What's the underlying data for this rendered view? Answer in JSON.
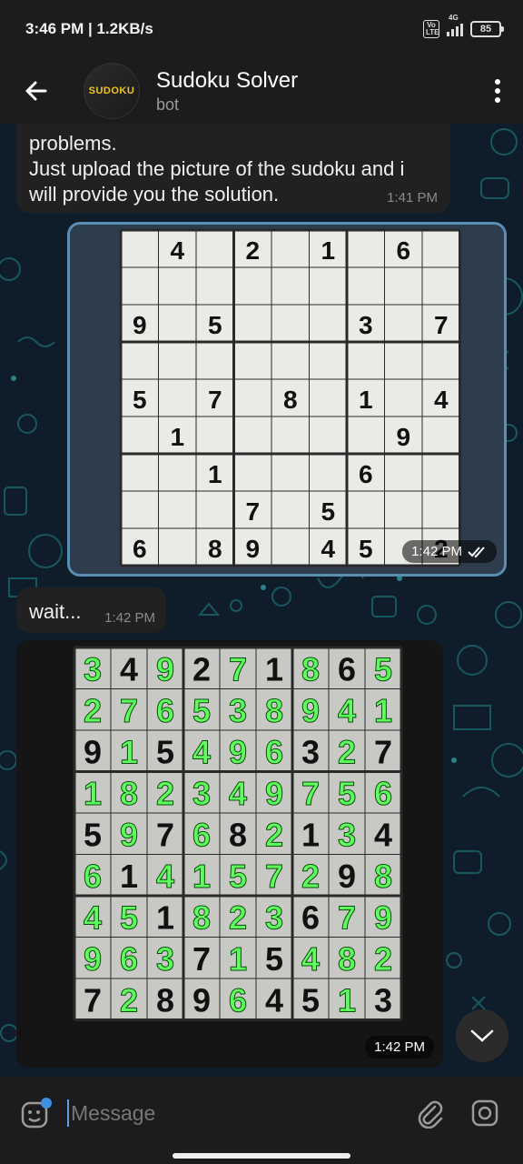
{
  "status": {
    "time": "3:46 PM | 1.2KB/s",
    "volte": "Vo LTE",
    "network": "4G",
    "battery": "85"
  },
  "header": {
    "avatar_text": "SUDOKU",
    "title": "Sudoku Solver",
    "subtitle": "bot"
  },
  "messages": [
    {
      "text": "problems.\nJust upload the picture of the sudoku and i will provide you the solution.",
      "time": "1:41 PM"
    },
    {
      "time": "1:42 PM"
    },
    {
      "text": "wait...",
      "time": "1:42 PM"
    },
    {
      "time": "1:42 PM"
    }
  ],
  "puzzle": [
    [
      "",
      "4",
      "",
      "2",
      "",
      "1",
      "",
      "6",
      ""
    ],
    [
      "",
      "",
      "",
      "",
      "",
      "",
      "",
      "",
      ""
    ],
    [
      "9",
      "",
      "5",
      "",
      "",
      "",
      "3",
      "",
      "7"
    ],
    [
      "",
      "",
      "",
      "",
      "",
      "",
      "",
      "",
      ""
    ],
    [
      "5",
      "",
      "7",
      "",
      "8",
      "",
      "1",
      "",
      "4"
    ],
    [
      "",
      "1",
      "",
      "",
      "",
      "",
      "",
      "9",
      ""
    ],
    [
      "",
      "",
      "1",
      "",
      "",
      "",
      "6",
      "",
      ""
    ],
    [
      "",
      "",
      "",
      "7",
      "",
      "5",
      "",
      "",
      ""
    ],
    [
      "6",
      "",
      "8",
      "9",
      "",
      "4",
      "5",
      "",
      "2"
    ]
  ],
  "solution": [
    [
      "3",
      "4",
      "9",
      "2",
      "7",
      "1",
      "8",
      "6",
      "5"
    ],
    [
      "2",
      "7",
      "6",
      "5",
      "3",
      "8",
      "9",
      "4",
      "1"
    ],
    [
      "9",
      "1",
      "5",
      "4",
      "9",
      "6",
      "3",
      "2",
      "7"
    ],
    [
      "1",
      "8",
      "2",
      "3",
      "4",
      "9",
      "7",
      "5",
      "6"
    ],
    [
      "5",
      "9",
      "7",
      "6",
      "8",
      "2",
      "1",
      "3",
      "4"
    ],
    [
      "6",
      "1",
      "4",
      "1",
      "5",
      "7",
      "2",
      "9",
      "8"
    ],
    [
      "4",
      "5",
      "1",
      "8",
      "2",
      "3",
      "6",
      "7",
      "9"
    ],
    [
      "9",
      "6",
      "3",
      "7",
      "1",
      "5",
      "4",
      "8",
      "2"
    ],
    [
      "7",
      "2",
      "8",
      "9",
      "6",
      "4",
      "5",
      "1",
      "3"
    ]
  ],
  "given_mask": [
    [
      0,
      1,
      0,
      1,
      0,
      1,
      0,
      1,
      0
    ],
    [
      0,
      0,
      0,
      0,
      0,
      0,
      0,
      0,
      0
    ],
    [
      1,
      0,
      1,
      0,
      0,
      0,
      1,
      0,
      1
    ],
    [
      0,
      0,
      0,
      0,
      0,
      0,
      0,
      0,
      0
    ],
    [
      1,
      0,
      1,
      0,
      1,
      0,
      1,
      0,
      1
    ],
    [
      0,
      1,
      0,
      0,
      0,
      0,
      0,
      1,
      0
    ],
    [
      0,
      0,
      1,
      0,
      0,
      0,
      1,
      0,
      0
    ],
    [
      0,
      0,
      0,
      1,
      0,
      1,
      0,
      0,
      0
    ],
    [
      1,
      0,
      1,
      1,
      0,
      1,
      1,
      0,
      1
    ]
  ],
  "input": {
    "placeholder": "Message"
  },
  "colors": {
    "solution_digit": "#5dff5d",
    "given_digit": "#111111",
    "accent": "#5aa0e6"
  },
  "icons": {
    "back": "arrow-left-icon",
    "menu": "more-vertical-icon",
    "emoji": "sticker-icon",
    "attach": "paperclip-icon",
    "camera": "instagram-camera-icon",
    "scroll": "chevron-down-icon"
  }
}
